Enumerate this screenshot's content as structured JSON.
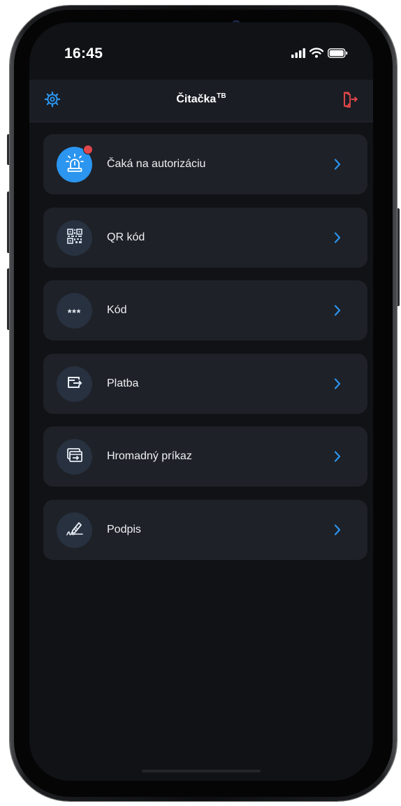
{
  "status_bar": {
    "time": "16:45",
    "icons": [
      "cellular-signal-icon",
      "wifi-icon",
      "battery-icon"
    ]
  },
  "header": {
    "title": "Čitačka",
    "title_superscript": "TB",
    "left_icon": "settings-gear-icon",
    "right_icon": "logout-icon"
  },
  "colors": {
    "accent": "#2b95f0",
    "logout": "#e0474b",
    "badge": "#e0474b",
    "card_bg": "#1e2127",
    "screen_bg": "#101216"
  },
  "menu": {
    "items": [
      {
        "label": "Čaká na autorizáciu",
        "icon": "alarm-light-icon",
        "badge": true
      },
      {
        "label": "QR kód",
        "icon": "qr-code-icon"
      },
      {
        "label": "Kód",
        "icon": "code-asterisks-icon",
        "icon_text": "***"
      },
      {
        "label": "Platba",
        "icon": "payment-icon"
      },
      {
        "label": "Hromadný príkaz",
        "icon": "bulk-order-icon"
      },
      {
        "label": "Podpis",
        "icon": "signature-icon"
      }
    ]
  }
}
